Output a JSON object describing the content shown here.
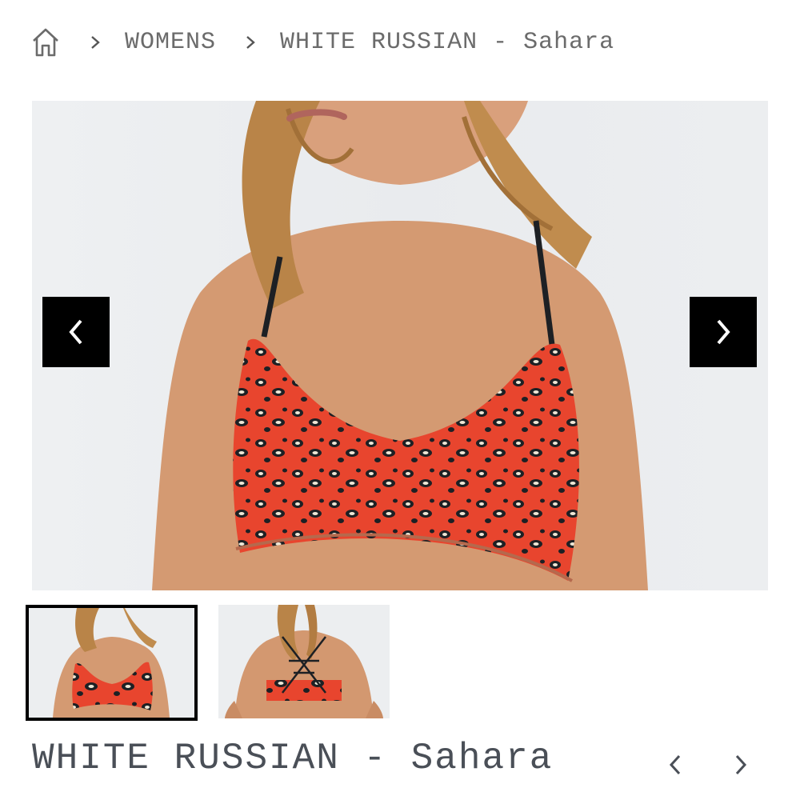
{
  "breadcrumb": {
    "home_icon": "home-icon",
    "separator_icon": "chevron-right-icon",
    "items": [
      "WOMENS",
      "WHITE RUSSIAN - Sahara"
    ]
  },
  "gallery": {
    "prev_icon": "chevron-left-icon",
    "next_icon": "chevron-right-icon",
    "active_thumbnail": 1,
    "thumbnail_count": 2
  },
  "product": {
    "title": "WHITE RUSSIAN - Sahara",
    "prev_icon": "chevron-left-icon",
    "next_icon": "chevron-right-icon"
  },
  "colors": {
    "print": "#e8452e",
    "arrow_bg": "#000000",
    "text": "#5a5a5a"
  }
}
